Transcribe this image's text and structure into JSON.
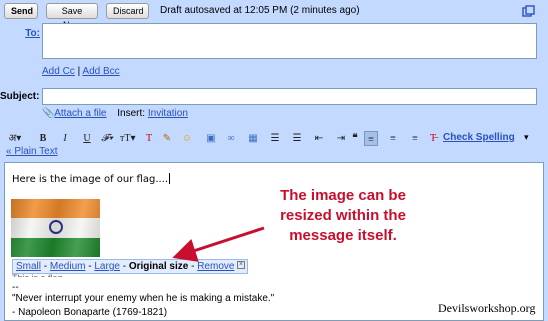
{
  "toolbar_top": {
    "send_label": "Send",
    "save_now_label": "Save Now",
    "discard_label": "Discard",
    "draft_status": "Draft autosaved at 12:05 PM (2 minutes ago)"
  },
  "compose": {
    "to_label": "To:",
    "to_value": "",
    "add_cc": "Add Cc",
    "cc_separator": "|",
    "add_bcc": "Add Bcc",
    "subject_label": "Subject:",
    "subject_value": "",
    "attach_label": "Attach a file",
    "insert_label": "Insert:",
    "invitation_label": "Invitation"
  },
  "format_toolbar": {
    "check_spelling": "Check Spelling",
    "plain_text": "« Plain Text",
    "tools": [
      "font",
      "bold",
      "italic",
      "underline",
      "font-size",
      "text-color",
      "highlight",
      "emoticon",
      "link",
      "image",
      "numbered-list",
      "bulleted-list",
      "indent-less",
      "indent-more",
      "quote",
      "align-left",
      "align-center",
      "align-right",
      "remove-formatting"
    ]
  },
  "editor": {
    "body_text": "Here is the image of our flag....",
    "image_sizes": {
      "small": "Small",
      "medium": "Medium",
      "large": "Large",
      "original": "Original size",
      "remove": "Remove",
      "separator": " - "
    },
    "cut_text": "This is a flag",
    "sig_dashes": "--",
    "sig_quote": "\"Never interrupt your enemy when he is making a mistake.\"",
    "sig_author": "- Napoleon Bonaparte (1769-1821)"
  },
  "annotation": {
    "callout_text": "The image can be resized within the message itself.",
    "callout_color": "#c8102e"
  },
  "watermark": "Devilsworkshop.org",
  "colors": {
    "frame": "#c3d9ff",
    "link": "#2a52be"
  }
}
